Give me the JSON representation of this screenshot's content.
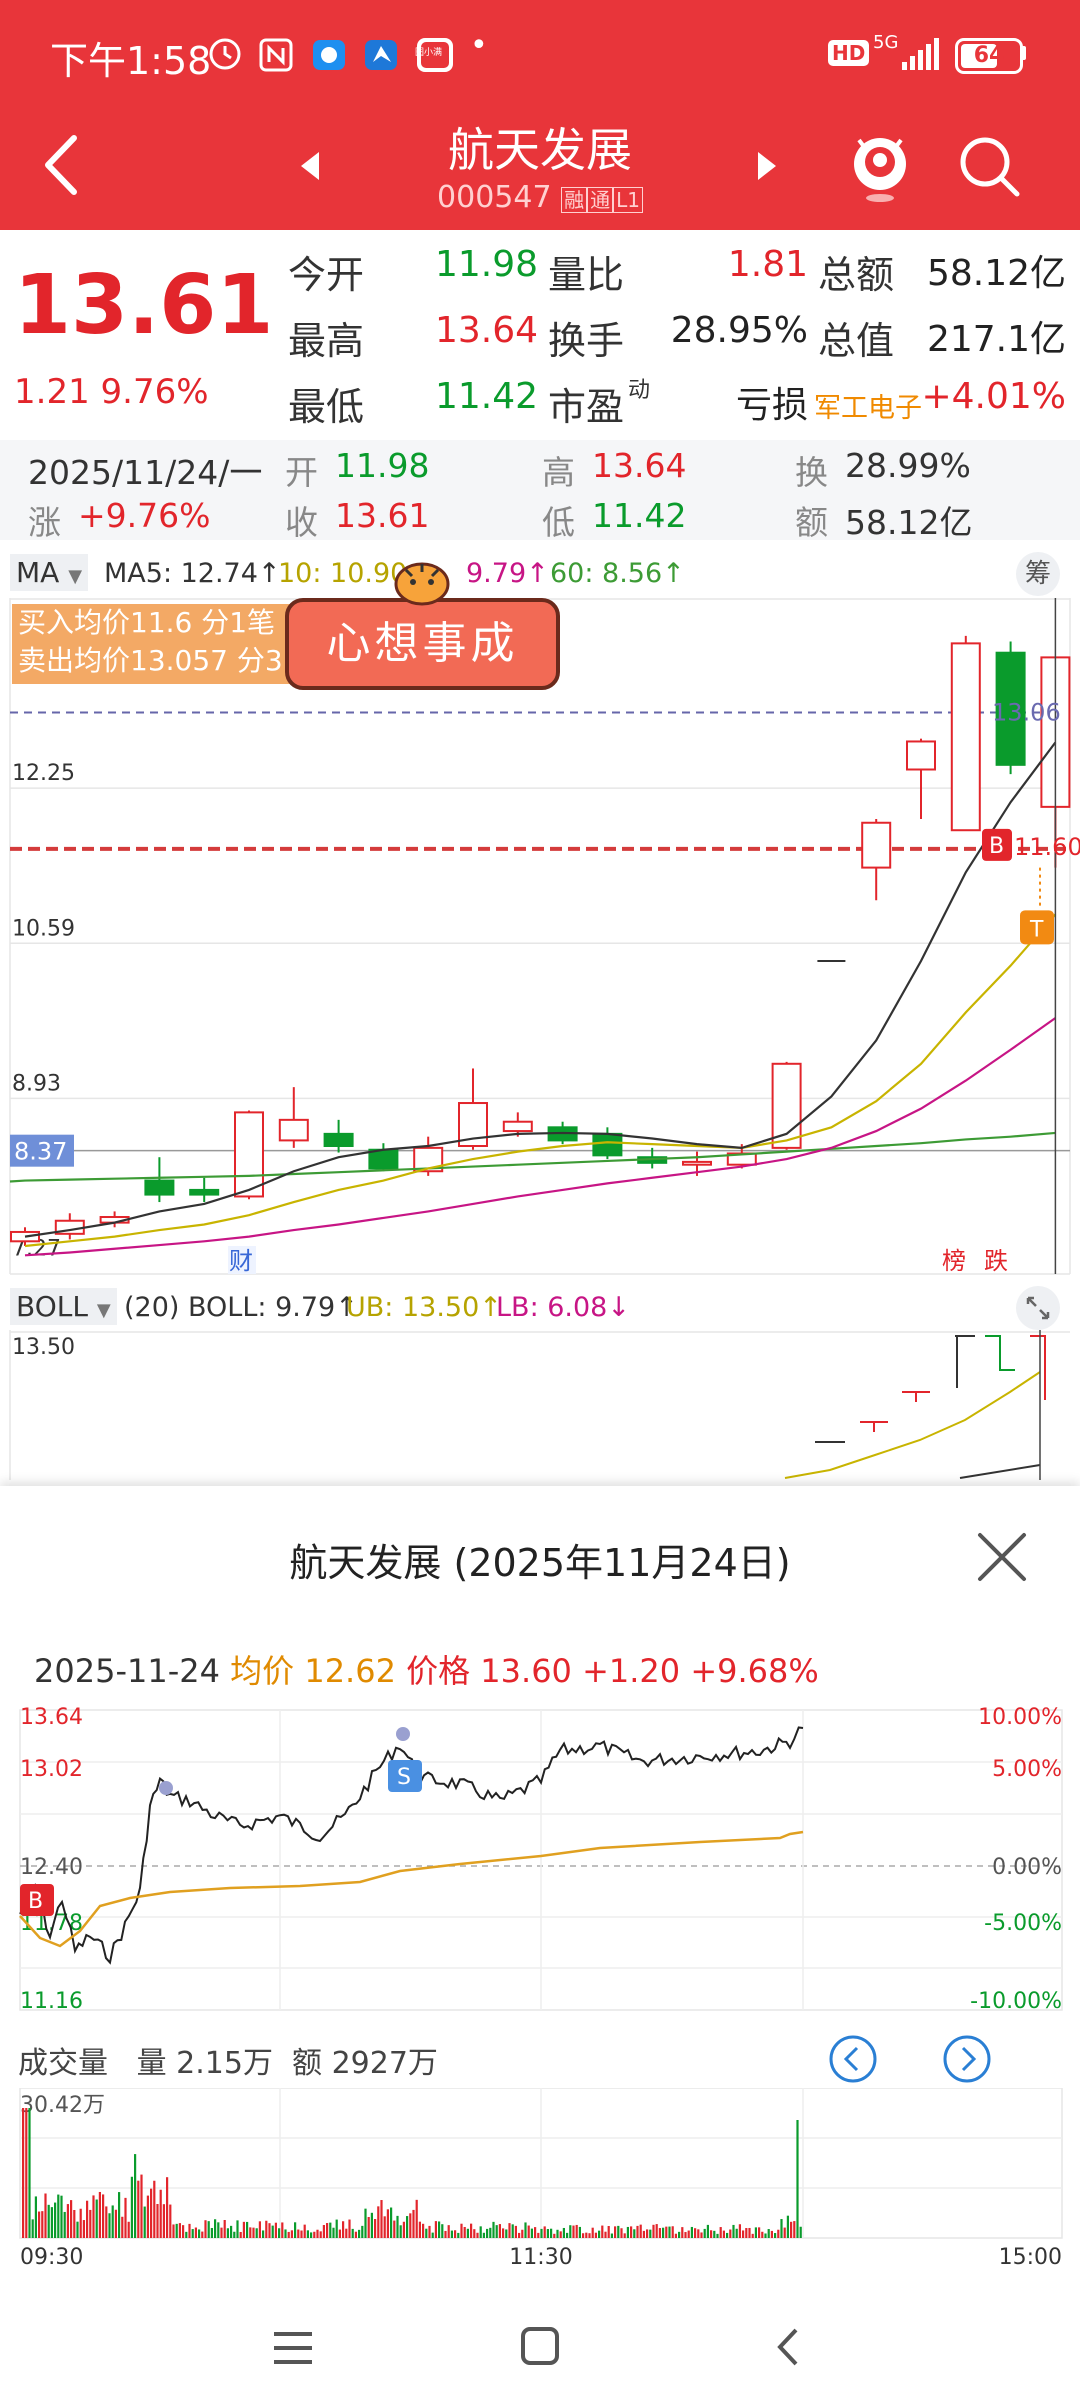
{
  "status": {
    "time": "下午1:58",
    "network": "5G",
    "battery": "64",
    "hd": "HD",
    "dot": "•",
    "app_icon_label": "图小满"
  },
  "header": {
    "title": "航天发展",
    "code": "000547",
    "badge_rong": "融",
    "badge_tong": "通",
    "badge_level": "L1"
  },
  "quote": {
    "price": "13.61",
    "change": "1.21",
    "change_pct": "9.76%",
    "rows": [
      [
        {
          "l": "今开",
          "v": "11.98",
          "c": "green"
        },
        {
          "l": "量比",
          "v": "1.81",
          "c": "red"
        },
        {
          "l": "总额",
          "v": "58.12亿",
          "c": "dark"
        }
      ],
      [
        {
          "l": "最高",
          "v": "13.64",
          "c": "red"
        },
        {
          "l": "换手",
          "v": "28.95%",
          "c": "dark"
        },
        {
          "l": "总值",
          "v": "217.1亿",
          "c": "dark"
        }
      ],
      [
        {
          "l": "最低",
          "v": "11.42",
          "c": "green"
        },
        {
          "l": "市盈",
          "sup": "动",
          "v": "亏损",
          "c": "dark"
        },
        {
          "l": "军工电子",
          "v": "+4.01%",
          "c": "red"
        }
      ]
    ]
  },
  "daybar": {
    "date": "2025/11/24/一",
    "open_l": "开",
    "open_v": "11.98",
    "high_l": "高",
    "high_v": "13.64",
    "turn_l": "换",
    "turn_v": "28.99%",
    "chg_l": "涨",
    "chg_v": "+9.76%",
    "close_l": "收",
    "close_v": "13.61",
    "low_l": "低",
    "low_v": "11.42",
    "amt_l": "额",
    "amt_v": "58.12亿"
  },
  "kline": {
    "indicator": "MA",
    "ma5": "MA5: 12.74↑",
    "ma10": "10: 10.90",
    "ma20": "9.79↑",
    "ma60": "60: 8.56↑",
    "chip_btn": "筹",
    "buy_avg": "买入均价11.6 分1笔",
    "sell_avg": "卖出均价13.057 分3",
    "sticker": "心想事成",
    "axis": [
      "12.25",
      "10.59",
      "8.93",
      "7.27"
    ],
    "current_tag": "8.37",
    "right_tag": "13.06",
    "b_tag": "B",
    "b_price": "11.60",
    "t_tag": "T",
    "cai": "财",
    "bang": "榜",
    "die": "跌",
    "colors": {
      "up": "#e2252b",
      "down": "#0a9b2c",
      "ma5": "#333333",
      "ma10": "#c8b400",
      "ma20": "#c71585",
      "ma60": "#3d9b35"
    }
  },
  "boll": {
    "name": "BOLL",
    "params": "(20) BOLL: 9.79↑",
    "ub": "UB: 13.50↑",
    "lb": "LB: 6.08↓",
    "axis_top": "13.50"
  },
  "sheet": {
    "title": "航天发展 (2025年11月24日)",
    "date": "2025-11-24",
    "avg_l": "均价",
    "avg_v": "12.62",
    "price_l": "价格",
    "price_v": "13.60",
    "chg": "+1.20",
    "chg_pct": "+9.68%",
    "left_axis": [
      "13.64",
      "13.02",
      "12.40",
      "11.78",
      "11.16"
    ],
    "right_axis": [
      "10.00%",
      "5.00%",
      "0.00%",
      "-5.00%",
      "-10.00%"
    ],
    "b_tag": "B",
    "s_tag": "S",
    "vol_title": "成交量",
    "vol_l": "量",
    "vol_v": "2.15万",
    "amt_l": "额",
    "amt_v": "2927万",
    "vol_max": "30.42万",
    "time_axis": [
      "09:30",
      "11:30",
      "15:00"
    ]
  }
}
